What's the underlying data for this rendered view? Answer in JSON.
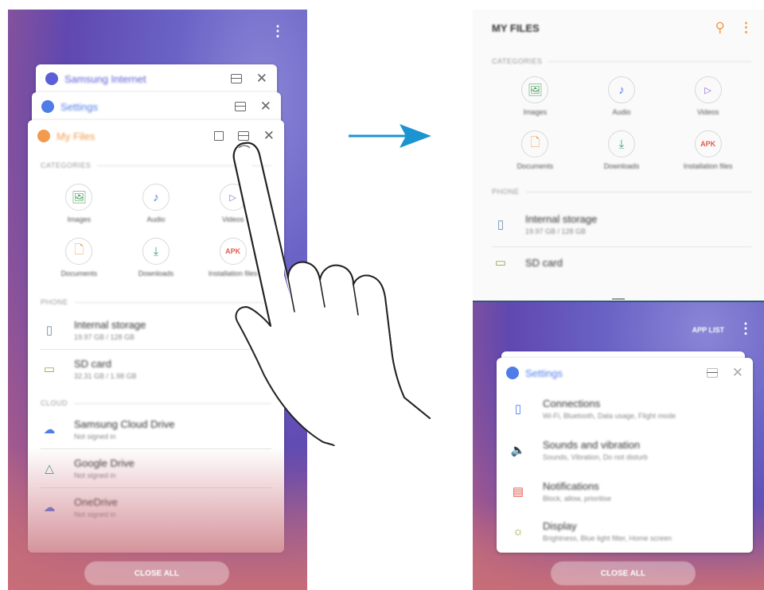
{
  "colors": {
    "accent": "#f29b4c",
    "settings_blue": "#4f7de8",
    "samsung_internet": "#5a5fd6",
    "apk_red": "#e55a4e",
    "arrow": "#1c94d2"
  },
  "left": {
    "close_all_label": "CLOSE ALL",
    "cards": {
      "samsung_internet": {
        "title": "Samsung Internet",
        "icon": "samsung-internet-icon"
      },
      "settings": {
        "title": "Settings",
        "icon": "settings-gear-icon"
      },
      "my_files": {
        "title": "My Files",
        "categories_label": "CATEGORIES",
        "categories": [
          "Images",
          "Audio",
          "Videos",
          "Documents",
          "Downloads",
          "Installation files"
        ],
        "phone_label": "PHONE",
        "storage": [
          {
            "title": "Internal storage",
            "sub": "19.97 GB / 128 GB"
          },
          {
            "title": "SD card",
            "sub": "32.31 GB / 1.98 GB"
          }
        ],
        "cloud_label": "CLOUD",
        "cloud": [
          {
            "title": "Samsung Cloud Drive",
            "sub": "Not signed in"
          },
          {
            "title": "Google Drive",
            "sub": "Not signed in"
          },
          {
            "title": "OneDrive",
            "sub": "Not signed in"
          }
        ]
      }
    }
  },
  "right": {
    "my_files": {
      "title": "MY FILES",
      "categories_label": "CATEGORIES",
      "categories": [
        "Images",
        "Audio",
        "Videos",
        "Documents",
        "Downloads",
        "Installation files"
      ],
      "phone_label": "PHONE",
      "storage": [
        {
          "title": "Internal storage",
          "sub": "19.97 GB / 128 GB"
        },
        {
          "title": "SD card",
          "sub": ""
        }
      ]
    },
    "app_list_label": "APP LIST",
    "close_all_label": "CLOSE ALL",
    "settings": {
      "title": "Settings",
      "items": [
        {
          "title": "Connections",
          "sub": "Wi-Fi, Bluetooth, Data usage, Flight mode",
          "icon": "connections-icon"
        },
        {
          "title": "Sounds and vibration",
          "sub": "Sounds, Vibration, Do not disturb",
          "icon": "sound-icon"
        },
        {
          "title": "Notifications",
          "sub": "Block, allow, prioritise",
          "icon": "notifications-icon"
        },
        {
          "title": "Display",
          "sub": "Brightness, Blue light filter, Home screen",
          "icon": "display-icon"
        }
      ]
    }
  },
  "apk_text": "APK"
}
